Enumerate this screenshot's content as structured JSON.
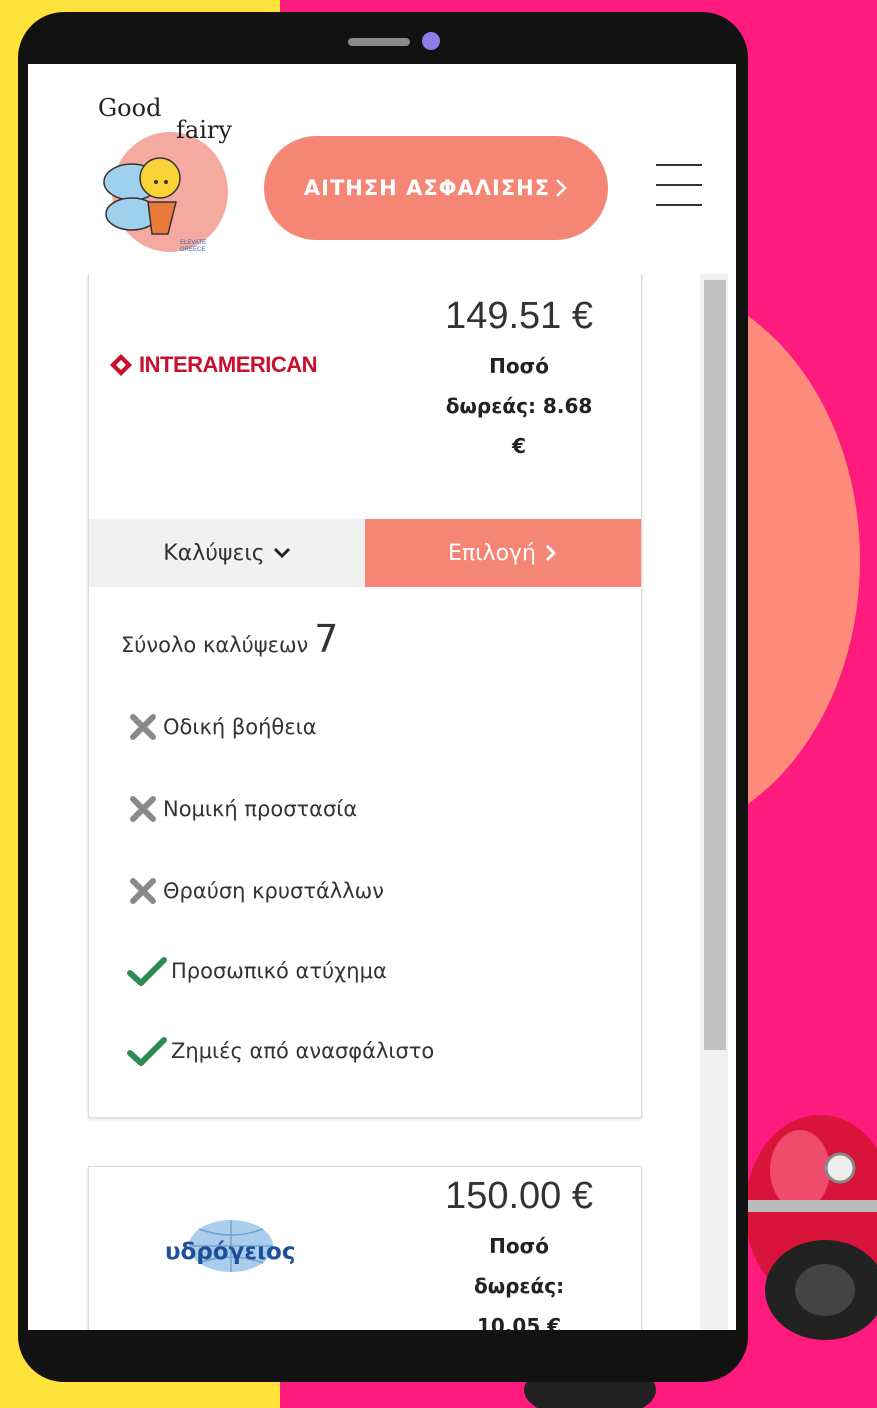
{
  "header": {
    "logo_line1": "Good",
    "logo_line2": "fairy",
    "logo_small1": "ELEVATE",
    "logo_small2": "GREECE",
    "cta_label": "ΑΙΤΗΣΗ ΑΣΦΑΛΙΣΗΣ",
    "cta_icon": "chevron-right-icon",
    "menu_icon": "hamburger-icon"
  },
  "offers": [
    {
      "insurer": "INTERAMERICAN",
      "price": "149.51 €",
      "donation_line1": "Ποσό",
      "donation_line2": "δωρεάς: 8.68",
      "donation_line3": "€",
      "coverages_label": "Καλύψεις",
      "select_label": "Επιλογή",
      "total_label": "Σύνολο καλύψεων",
      "total_count": "7",
      "coverages": [
        {
          "label": "Οδική βοήθεια",
          "included": false
        },
        {
          "label": "Νομική προστασία",
          "included": false
        },
        {
          "label": "Θραύση κρυστάλλων",
          "included": false
        },
        {
          "label": "Προσωπικό ατύχημα",
          "included": true
        },
        {
          "label": "Ζημιές από ανασφάλιστο",
          "included": true
        }
      ]
    },
    {
      "insurer": "υδρόγειος",
      "price": "150.00 €",
      "donation_line1": "Ποσό",
      "donation_line2": "δωρεάς:",
      "donation_line3": "10.05 €"
    }
  ],
  "colors": {
    "accent": "#f58676",
    "check": "#2e8b57",
    "cross": "#8a8a8a",
    "background_pink": "#ff1a7d",
    "background_yellow": "#ffe23a"
  }
}
